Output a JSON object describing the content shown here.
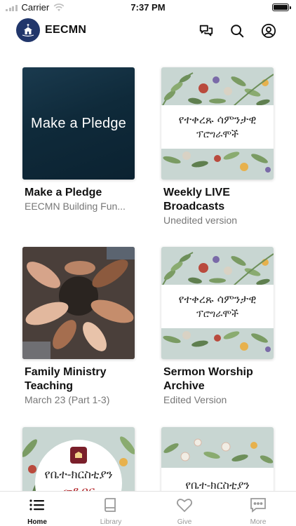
{
  "status_bar": {
    "carrier": "Carrier",
    "time": "7:37 PM",
    "signal_icon": "signal-icon",
    "wifi_icon": "wifi-icon",
    "battery_icon": "battery-icon"
  },
  "header": {
    "app_name": "EECMN",
    "logo_icon": "church-logo-icon",
    "actions": [
      "chat-icon",
      "search-icon",
      "account-icon"
    ]
  },
  "cards": [
    {
      "title": "Make a Pledge",
      "subtitle": "EECMN Building Fun...",
      "thumb_text": "Make a Pledge"
    },
    {
      "title": "Weekly LIVE Broadcasts",
      "subtitle": "Unedited version",
      "thumb_line1": "የተቀረጹ ሳምንታዊ",
      "thumb_line2": "ፕሮግራሞች"
    },
    {
      "title": "Family Ministry Teaching",
      "subtitle": "March 23 (Part 1-3)",
      "thumb_image": "praying-hands-photo"
    },
    {
      "title": "Sermon Worship Archive",
      "subtitle": "Edited Version",
      "thumb_line1": "የተቀረጹ ሳምንታዊ",
      "thumb_line2": "ፕሮግራሞች"
    },
    {
      "thumb_line1": "የቤተ-ክርስቲያን",
      "thumb_line2": "መደብር"
    },
    {
      "thumb_line1": "የቤተ-ክርስቲያን"
    }
  ],
  "tabbar": {
    "items": [
      {
        "label": "Home",
        "icon": "list-icon",
        "active": true
      },
      {
        "label": "Library",
        "icon": "book-icon",
        "active": false
      },
      {
        "label": "Give",
        "icon": "heart-icon",
        "active": false
      },
      {
        "label": "More",
        "icon": "more-icon",
        "active": false
      }
    ]
  },
  "colors": {
    "brand_navy": "#21366b",
    "pledge_bg": "#0f2a3a",
    "floral_bg": "#c8d6d2",
    "store_red": "#b3262b"
  }
}
